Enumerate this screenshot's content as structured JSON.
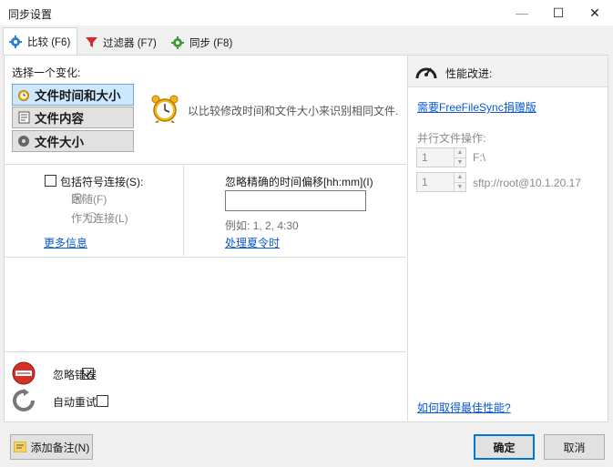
{
  "window": {
    "title": "同步设置",
    "minimize_glyph": "—",
    "maximize_glyph": "☐",
    "close_glyph": "✕"
  },
  "tabs": [
    {
      "label": "比较 (F6)",
      "icon": "gear-icon",
      "active": true
    },
    {
      "label": "过滤器 (F7)",
      "icon": "funnel-icon",
      "active": false
    },
    {
      "label": "同步 (F8)",
      "icon": "gear-icon",
      "active": false
    }
  ],
  "compare": {
    "choose_label": "选择一个变化:",
    "variants": [
      {
        "label": "文件时间和大小",
        "icon": "clock-icon",
        "selected": true
      },
      {
        "label": "文件内容",
        "icon": "document-icon",
        "selected": false
      },
      {
        "label": "文件大小",
        "icon": "disk-icon",
        "selected": false
      }
    ],
    "description": "以比较修改时间和文件大小来识别相同文件.",
    "symlink": {
      "checkbox_label": "包括符号连接(S):",
      "checked": false,
      "options": [
        {
          "label": "跟随(F)",
          "selected": true
        },
        {
          "label": "作为连接(L)",
          "selected": false
        }
      ]
    },
    "more_info": "更多信息",
    "time_shift": {
      "label": "忽略精确的时间偏移[hh:mm](I)",
      "value": "",
      "example": "例如: 1, 2, 4:30",
      "dst_link": "处理夏令时"
    },
    "ignore_errors": {
      "label": "忽略错误",
      "checked": true
    },
    "auto_retry": {
      "label": "自动重试",
      "checked": false
    }
  },
  "performance": {
    "title": "性能改进:",
    "donate_link": "需要FreeFileSync捐赠版",
    "parallel_label": "并行文件操作:",
    "rows": [
      {
        "value": "1",
        "path": "F:\\"
      },
      {
        "value": "1",
        "path": "sftp://root@10.1.20.17"
      }
    ],
    "best_link": "如何取得最佳性能?"
  },
  "footer": {
    "add_note": "添加备注(N)",
    "ok": "确定",
    "cancel": "取消"
  },
  "colors": {
    "accent": "#0078d7",
    "link": "#0b57d0",
    "selected_variant": "#cce8ff"
  }
}
